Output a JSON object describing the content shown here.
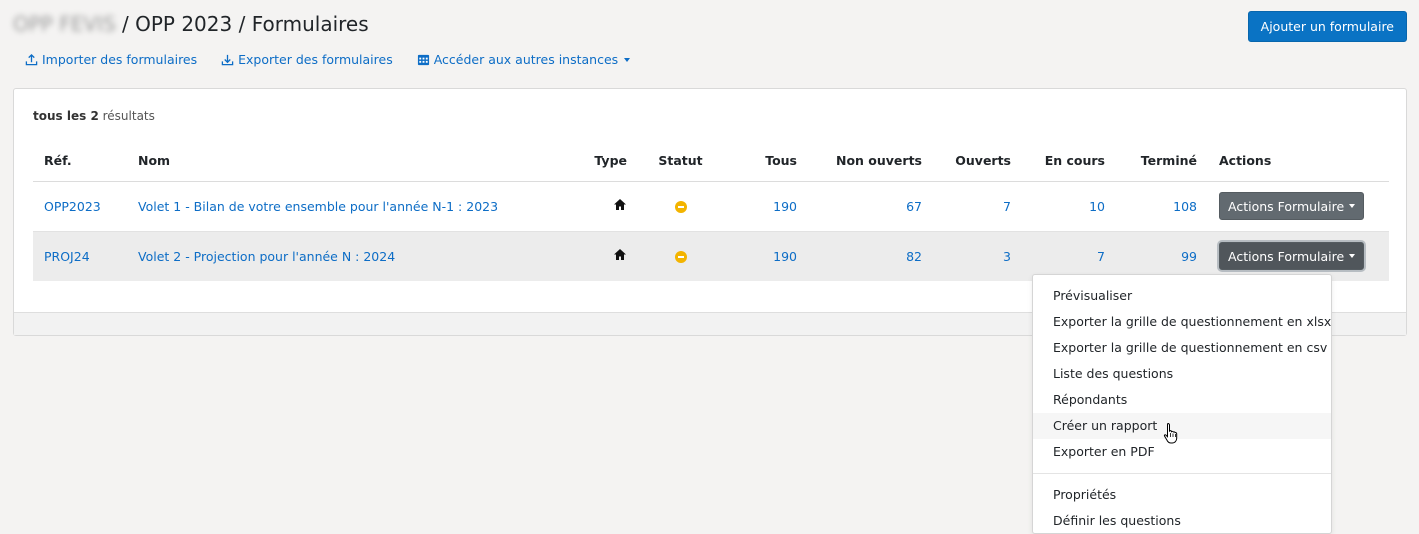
{
  "breadcrumb": {
    "org": "OPP FEVIS",
    "separator1": "/",
    "instance": "OPP 2023",
    "separator2": "/",
    "page": "Formulaires"
  },
  "header": {
    "add_button": "Ajouter un formulaire"
  },
  "toolbar": {
    "import_label": "Importer des formulaires",
    "export_label": "Exporter des formulaires",
    "instances_label": "Accéder aux autres instances"
  },
  "results": {
    "prefix": "tous les",
    "count": "2",
    "suffix": "résultats"
  },
  "table": {
    "headers": {
      "ref": "Réf.",
      "name": "Nom",
      "type": "Type",
      "status": "Statut",
      "all": "Tous",
      "unopened": "Non ouverts",
      "opened": "Ouverts",
      "in_progress": "En cours",
      "done": "Terminé",
      "actions": "Actions"
    },
    "rows": [
      {
        "ref": "OPP2023",
        "name": "Volet 1 - Bilan de votre ensemble pour l'année N-1 : 2023",
        "type_icon": "home-icon",
        "status_icon": "minus-circle-icon",
        "all": "190",
        "unopened": "67",
        "opened": "7",
        "in_progress": "10",
        "done": "108",
        "action_label": "Actions Formulaire"
      },
      {
        "ref": "PROJ24",
        "name": "Volet 2 - Projection pour l'année N : 2024",
        "type_icon": "home-icon",
        "status_icon": "minus-circle-icon",
        "all": "190",
        "unopened": "82",
        "opened": "3",
        "in_progress": "7",
        "done": "99",
        "action_label": "Actions Formulaire"
      }
    ]
  },
  "dropdown": {
    "items": [
      "Prévisualiser",
      "Exporter la grille de questionnement en xlsx",
      "Exporter la grille de questionnement en csv",
      "Liste des questions",
      "Répondants",
      "Créer un rapport",
      "Exporter en PDF"
    ],
    "items2": [
      "Propriétés",
      "Définir les questions"
    ]
  },
  "colors": {
    "accent": "#0a73c4",
    "link": "#0d6dc6",
    "status": "#f3b400",
    "action_button": "#626a70"
  }
}
